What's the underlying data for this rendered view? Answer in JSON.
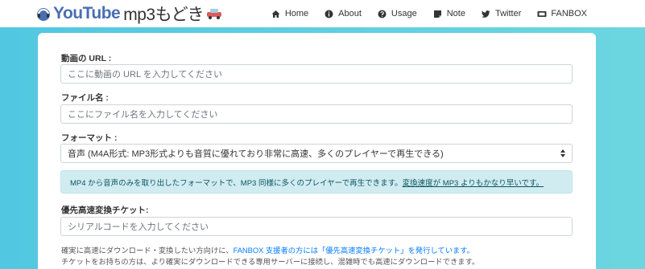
{
  "brand": {
    "name_part1": "YouTube",
    "name_part2": "mp3もどき"
  },
  "nav": {
    "items": [
      {
        "label": "Home",
        "icon": "home-icon"
      },
      {
        "label": "About",
        "icon": "info-circle-icon"
      },
      {
        "label": "Usage",
        "icon": "question-circle-icon"
      },
      {
        "label": "Note",
        "icon": "sticky-note-icon"
      },
      {
        "label": "Twitter",
        "icon": "twitter-icon"
      },
      {
        "label": "FANBOX",
        "icon": "ticket-icon"
      }
    ]
  },
  "form": {
    "url_label": "動画の URL :",
    "url_placeholder": "ここに動画の URL を入力してください",
    "filename_label": "ファイル名 :",
    "filename_placeholder": "ここにファイル名を入力してください",
    "format_label": "フォーマット :",
    "format_selected": "音声 (M4A形式: MP3形式よりも音質に優れており非常に高速、多くのプレイヤーで再生できる)",
    "alert_text": "MP4 から音声のみを取り出したフォーマットで、MP3 同様に多くのプレイヤーで再生できます。",
    "alert_link": "変換速度が MP3 よりもかなり早いです。",
    "ticket_label": "優先高速変換チケット:",
    "ticket_placeholder": "シリアルコードを入力してください",
    "note1_prefix": "確実に高速にダウンロード・変換したい方向けに、",
    "note1_link": "FANBOX 支援者の方には「優先高速変換チケット」を発行しています。",
    "note2": "チケットをお持ちの方は、より確実にダウンロードできる専用サーバーに接続し、混雑時でも高速にダウンロードできます。"
  },
  "colors": {
    "background_start": "#52c7e1",
    "background_end": "#6cd6e0",
    "alert_bg": "#d1ecf1",
    "link": "#007bff"
  }
}
